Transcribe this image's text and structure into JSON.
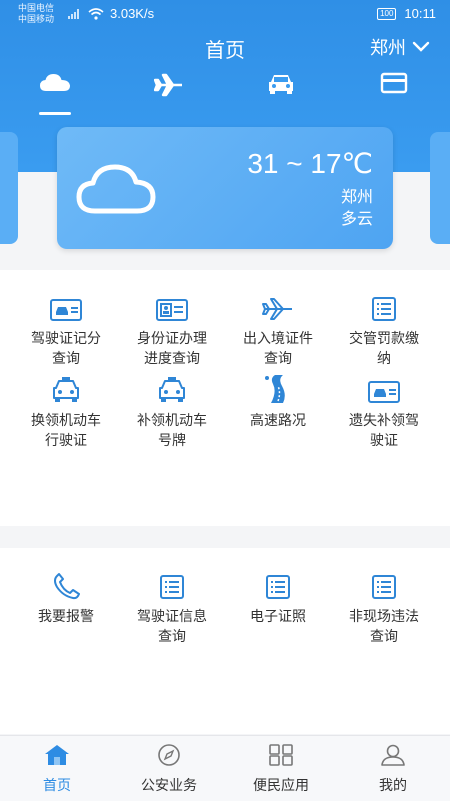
{
  "status_bar": {
    "carrier1": "中国电信",
    "carrier2": "中国移动",
    "speed": "3.03K/s",
    "battery": "100",
    "time": "10:11"
  },
  "header": {
    "title": "首页",
    "city": "郑州"
  },
  "top_tabs": [
    {
      "icon": "cloud-icon"
    },
    {
      "icon": "airplane-icon"
    },
    {
      "icon": "car-icon"
    },
    {
      "icon": "card-icon"
    }
  ],
  "weather": {
    "temp": "31 ~ 17℃",
    "city": "郑州",
    "condition": "多云",
    "icon": "cloud-icon"
  },
  "services": [
    {
      "line1": "驾驶证记分",
      "line2": "查询",
      "icon": "license-icon"
    },
    {
      "line1": "身份证办理",
      "line2": "进度查询",
      "icon": "id-card-icon"
    },
    {
      "line1": "出入境证件",
      "line2": "查询",
      "icon": "airplane-icon"
    },
    {
      "line1": "交管罚款缴",
      "line2": "纳",
      "icon": "list-icon"
    },
    {
      "line1": "换领机动车",
      "line2": "行驶证",
      "icon": "car-icon"
    },
    {
      "line1": "补领机动车",
      "line2": "号牌",
      "icon": "car-icon"
    },
    {
      "line1": "高速路况",
      "line2": "",
      "icon": "highway-icon"
    },
    {
      "line1": "遗失补领驾",
      "line2": "驶证",
      "icon": "license-icon"
    }
  ],
  "services2": [
    {
      "line1": "我要报警",
      "line2": "",
      "icon": "phone-icon"
    },
    {
      "line1": "驾驶证信息",
      "line2": "查询",
      "icon": "list-icon"
    },
    {
      "line1": "电子证照",
      "line2": "",
      "icon": "list-icon"
    },
    {
      "line1": "非现场违法",
      "line2": "查询",
      "icon": "list-icon"
    }
  ],
  "bottom_nav": [
    {
      "label": "首页",
      "icon": "home-icon",
      "active": true
    },
    {
      "label": "公安业务",
      "icon": "compass-icon",
      "active": false
    },
    {
      "label": "便民应用",
      "icon": "apps-grid-icon",
      "active": false
    },
    {
      "label": "我的",
      "icon": "user-icon",
      "active": false
    }
  ],
  "colors": {
    "primary": "#2e8ce3",
    "header": "#3a9cf0",
    "icon_blue": "#2f86d6"
  }
}
